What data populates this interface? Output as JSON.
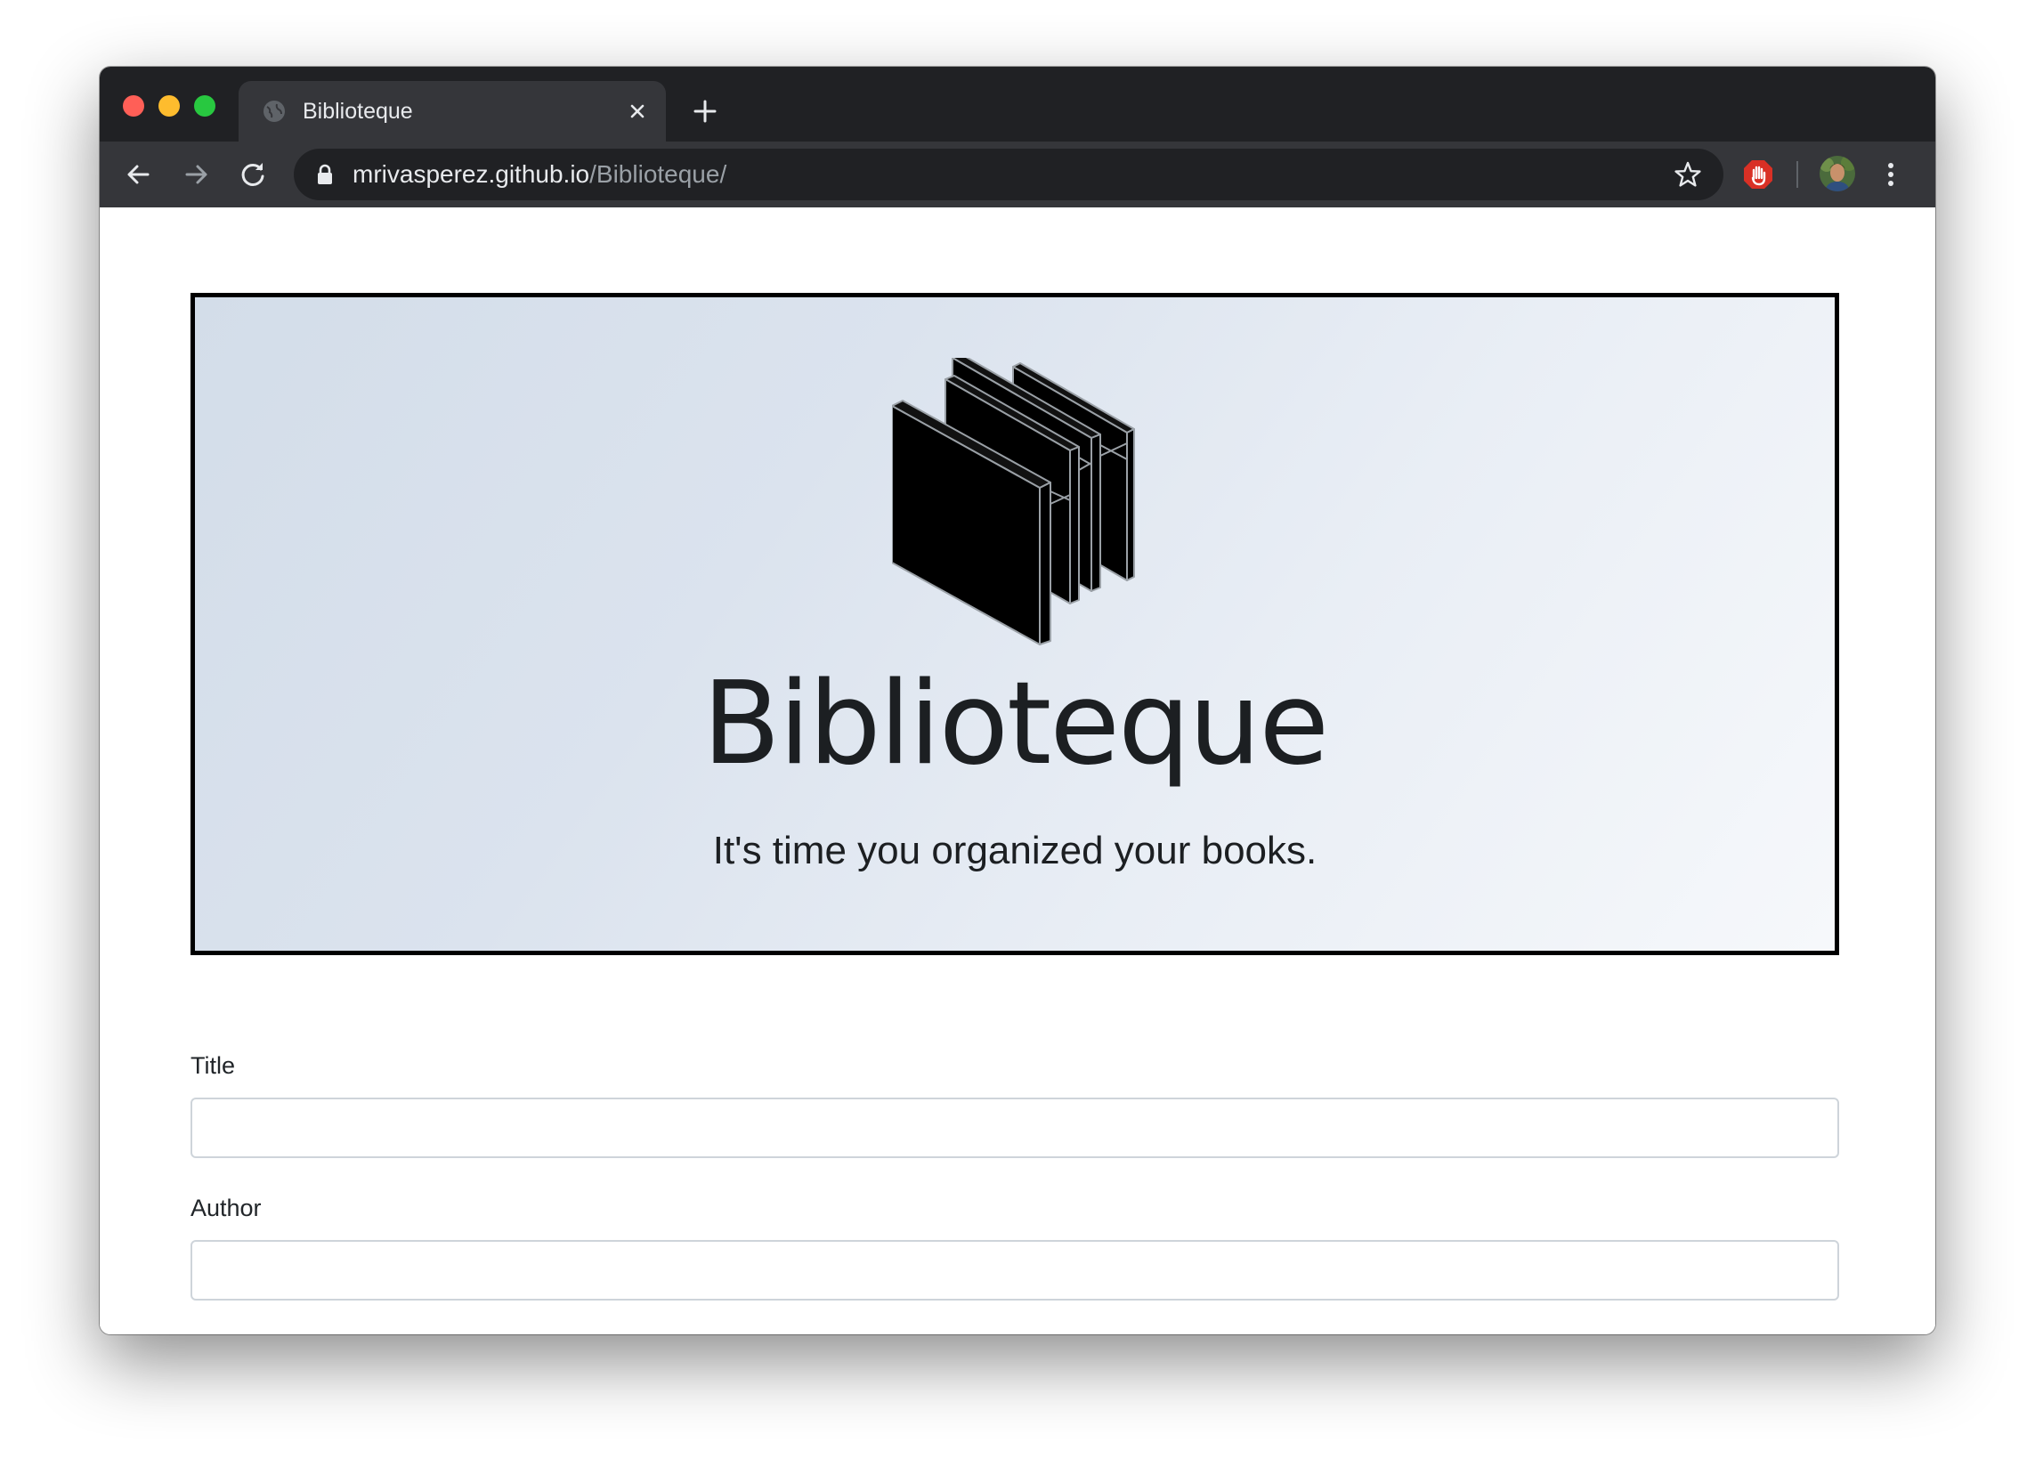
{
  "browser": {
    "tab_title": "Biblioteque",
    "url_host": "mrivasperez.github.io",
    "url_path": "/Biblioteque/",
    "icons": {
      "close_window": "traffic-light-red",
      "minimize_window": "traffic-light-yellow",
      "maximize_window": "traffic-light-green",
      "tab_favicon": "globe-icon",
      "tab_close": "close-icon",
      "new_tab": "plus-icon",
      "back": "arrow-left-icon",
      "forward": "arrow-right-icon",
      "reload": "reload-icon",
      "secure": "lock-icon",
      "bookmark": "star-icon",
      "extension": "stop-hand-icon",
      "profile": "avatar",
      "menu": "kebab-menu-icon"
    },
    "colors": {
      "tabstrip": "#202124",
      "toolbar": "#35363a",
      "omnibox": "#202124",
      "extension_red": "#d93025"
    }
  },
  "hero": {
    "title": "Biblioteque",
    "subtitle": "It's time you organized your books.",
    "logo": "stacked-books-logo"
  },
  "form": {
    "title_label": "Title",
    "title_value": "",
    "author_label": "Author",
    "author_value": ""
  }
}
